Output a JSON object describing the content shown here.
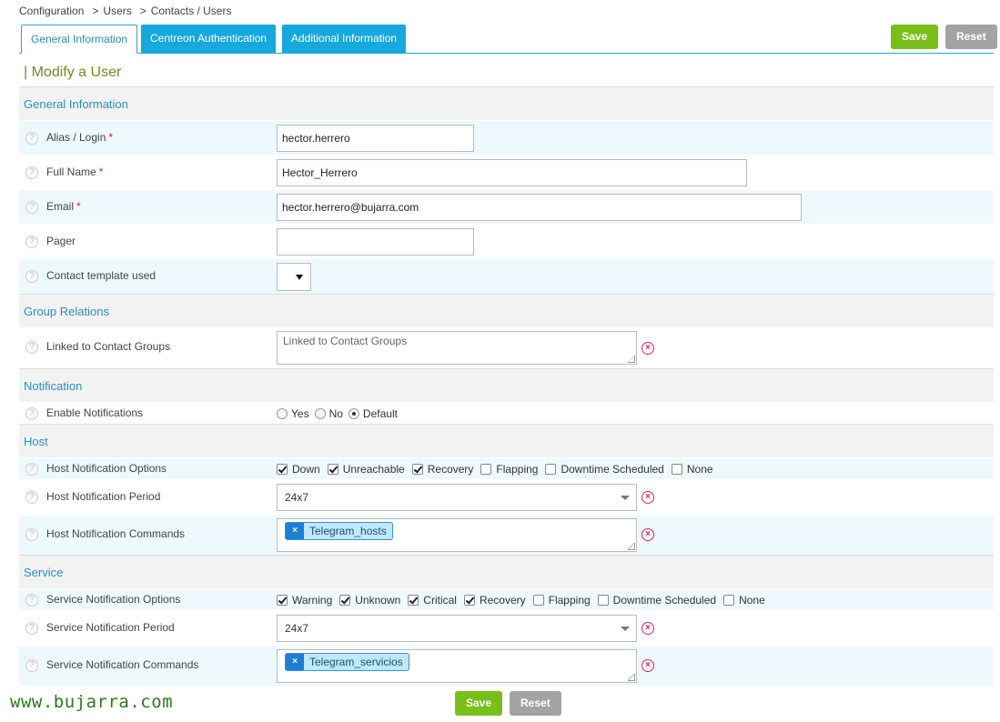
{
  "breadcrumb": [
    "Configuration",
    "Users",
    "Contacts / Users"
  ],
  "tabs": [
    "General Information",
    "Centreon Authentication",
    "Additional Information"
  ],
  "buttons": {
    "save": "Save",
    "reset": "Reset"
  },
  "page_title": "| Modify a User",
  "sections": {
    "general": "General Information",
    "groups": "Group Relations",
    "notification": "Notification",
    "host": "Host",
    "service": "Service"
  },
  "fields": {
    "alias": {
      "label": "Alias / Login",
      "value": "hector.herrero"
    },
    "fullname": {
      "label": "Full Name",
      "value": "Hector_Herrero"
    },
    "email": {
      "label": "Email",
      "value": "hector.herrero@bujarra.com"
    },
    "pager": {
      "label": "Pager",
      "value": ""
    },
    "template": {
      "label": "Contact template used",
      "value": ""
    },
    "contact_groups": {
      "label": "Linked to Contact Groups",
      "placeholder": "Linked to Contact Groups"
    },
    "enable_notifications": {
      "label": "Enable Notifications",
      "options": [
        "Yes",
        "No",
        "Default"
      ],
      "selected": "Default"
    },
    "host_options": {
      "label": "Host Notification Options",
      "options": [
        {
          "label": "Down",
          "checked": true
        },
        {
          "label": "Unreachable",
          "checked": true
        },
        {
          "label": "Recovery",
          "checked": true
        },
        {
          "label": "Flapping",
          "checked": false
        },
        {
          "label": "Downtime Scheduled",
          "checked": false
        },
        {
          "label": "None",
          "checked": false
        }
      ]
    },
    "host_period": {
      "label": "Host Notification Period",
      "value": "24x7"
    },
    "host_commands": {
      "label": "Host Notification Commands",
      "chip": "Telegram_hosts",
      "chip_remove": "×"
    },
    "service_options": {
      "label": "Service Notification Options",
      "options": [
        {
          "label": "Warning",
          "checked": true
        },
        {
          "label": "Unknown",
          "checked": true
        },
        {
          "label": "Critical",
          "checked": true
        },
        {
          "label": "Recovery",
          "checked": true
        },
        {
          "label": "Flapping",
          "checked": false
        },
        {
          "label": "Downtime Scheduled",
          "checked": false
        },
        {
          "label": "None",
          "checked": false
        }
      ]
    },
    "service_period": {
      "label": "Service Notification Period",
      "value": "24x7"
    },
    "service_commands": {
      "label": "Service Notification Commands",
      "chip": "Telegram_servicios",
      "chip_remove": "×"
    }
  },
  "required_mark": "*",
  "help_glyph": "?",
  "clear_glyph": "×",
  "watermark": "www.bujarra.com",
  "colors": {
    "tab": "#16a8de",
    "save": "#79bf1a",
    "reset": "#a3a3a3",
    "section_text": "#2a8fc4",
    "title": "#6b8e23"
  }
}
